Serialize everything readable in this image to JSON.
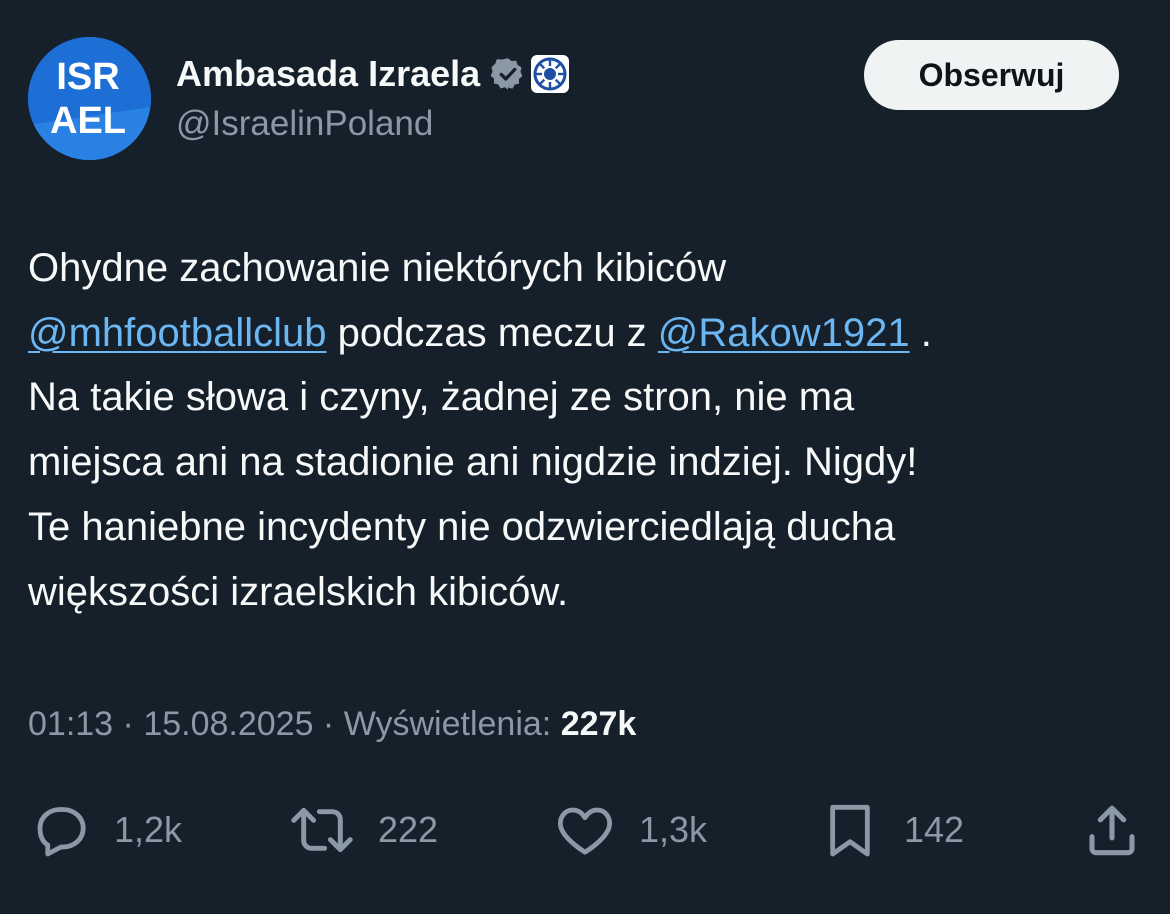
{
  "account": {
    "display_name": "Ambasada Izraela",
    "handle": "@IsraelinPoland",
    "avatar_text_top": "ISR",
    "avatar_text_bottom": "AEL",
    "verified_icon": "verified-badge-icon",
    "org_badge_icon": "israel-emblem-icon"
  },
  "follow_button": {
    "label": "Obserwuj"
  },
  "tweet": {
    "line1": "Ohydne zachowanie niektórych kibiców",
    "mention1": "@mhfootballclub",
    "line2_mid": " podczas meczu z ",
    "mention2": "@Rakow1921",
    "line2_end": " .",
    "line3": "Na takie słowa i czyny, żadnej ze stron, nie ma",
    "line4": "miejsca ani na stadionie ani nigdzie indziej. Nigdy!",
    "line5": "Te haniebne incydenty nie odzwierciedlają ducha",
    "line6": "większości izraelskich kibiców."
  },
  "meta": {
    "time": "01:13",
    "separator": " · ",
    "date": "15.08.2025",
    "views_label": "Wyświetlenia: ",
    "views_count": "227k"
  },
  "actions": {
    "replies": "1,2k",
    "reposts": "222",
    "likes": "1,3k",
    "bookmarks": "142"
  },
  "colors": {
    "background": "#15202b",
    "text": "#f7f9f9",
    "secondary": "#8b98a5",
    "link": "#6cb6f2",
    "button_bg": "#eff3f4",
    "avatar_blue": "#1d6fd6"
  }
}
